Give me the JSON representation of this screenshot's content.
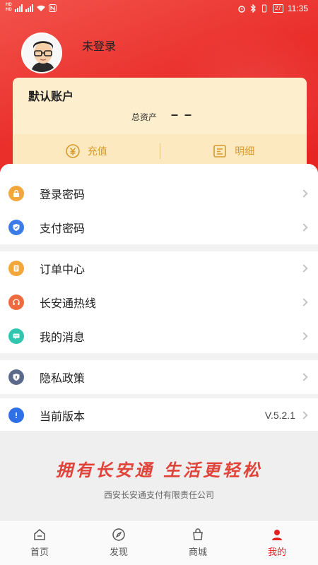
{
  "status_bar": {
    "hd_labels": [
      "HD",
      "HD"
    ],
    "time": "11:35",
    "battery": "27"
  },
  "profile": {
    "login_status": "未登录"
  },
  "account_card": {
    "title": "默认账户",
    "assets_label": "总资产",
    "assets_value": "– –",
    "recharge_label": "充值",
    "details_label": "明细"
  },
  "menu": {
    "group1": [
      {
        "label": "登录密码",
        "icon": "lock-icon",
        "color": "#f3a73b"
      },
      {
        "label": "支付密码",
        "icon": "shield-icon",
        "color": "#3b7be8"
      }
    ],
    "group2": [
      {
        "label": "订单中心",
        "icon": "order-icon",
        "color": "#f3a73b"
      },
      {
        "label": "长安通热线",
        "icon": "headset-icon",
        "color": "#ef6a3d"
      },
      {
        "label": "我的消息",
        "icon": "message-icon",
        "color": "#2fc5b1"
      }
    ],
    "group3": [
      {
        "label": "隐私政策",
        "icon": "privacy-shield-icon",
        "color": "#5b6a8a"
      }
    ],
    "group4": [
      {
        "label": "当前版本",
        "icon": "info-icon",
        "color": "#2f6fe8",
        "value": "V.5.2.1"
      }
    ]
  },
  "slogan": {
    "text": "拥有长安通  生活更轻松",
    "company": "西安长安通支付有限责任公司"
  },
  "tabbar": {
    "tabs": [
      {
        "label": "首页",
        "icon": "home-icon"
      },
      {
        "label": "发现",
        "icon": "compass-icon"
      },
      {
        "label": "商城",
        "icon": "shop-icon"
      },
      {
        "label": "我的",
        "icon": "user-icon"
      }
    ]
  },
  "colors": {
    "brand_red": "#e4201f",
    "card_bg": "#fdeecd",
    "card_accent": "#d79a2b"
  }
}
